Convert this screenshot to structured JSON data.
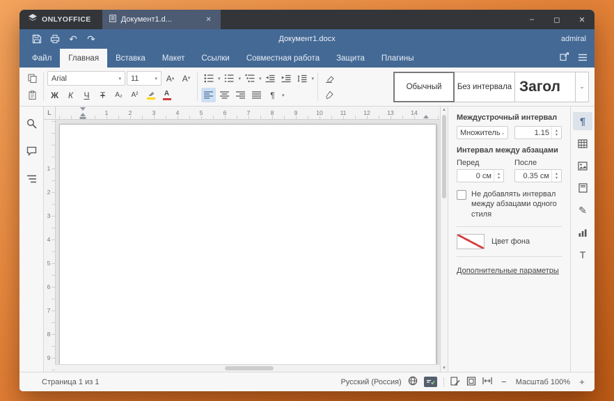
{
  "window": {
    "brand": "ONLYOFFICE",
    "doc_tab": "Документ1.d...",
    "tab_close": "✕",
    "controls": {
      "minimize": "–",
      "maximize": "◻",
      "close": "✕"
    }
  },
  "header": {
    "title": "Документ1.docx",
    "user": "admiral"
  },
  "menu": {
    "tabs": [
      {
        "label": "Файл"
      },
      {
        "label": "Главная"
      },
      {
        "label": "Вставка"
      },
      {
        "label": "Макет"
      },
      {
        "label": "Ссылки"
      },
      {
        "label": "Совместная работа"
      },
      {
        "label": "Защита"
      },
      {
        "label": "Плагины"
      }
    ]
  },
  "toolbar": {
    "font_name": "Arial",
    "font_size": "11",
    "bold": "Ж",
    "italic": "К",
    "underline": "Ч",
    "strikethrough": "Ŧ",
    "subscript": "A₂",
    "superscript": "A²",
    "increase_font": "A",
    "decrease_font": "A",
    "font_color_letter": "А",
    "pilcrow": "¶",
    "styles": [
      {
        "label": "Обычный"
      },
      {
        "label": "Без интервала"
      },
      {
        "label": "Загол"
      }
    ]
  },
  "rulers": {
    "tab_selector": "L",
    "horizontal": [
      "1",
      "2",
      "3",
      "4",
      "5",
      "6",
      "7",
      "8",
      "9",
      "10",
      "11",
      "12",
      "13",
      "14"
    ],
    "vertical": [
      "1",
      "2",
      "3",
      "4",
      "5",
      "6",
      "7",
      "8",
      "9"
    ]
  },
  "right_panel": {
    "line_spacing_title": "Междустрочный интервал",
    "multiplier": "Множитель",
    "multiplier_value": "1.15",
    "paragraph_spacing_title": "Интервал между абзацами",
    "before_label": "Перед",
    "after_label": "После",
    "before_value": "0 см",
    "after_value": "0.35 см",
    "checkbox_label": "Не добавлять интервал между абзацами одного стиля",
    "background_label": "Цвет фона",
    "advanced_link": "Дополнительные параметры"
  },
  "status": {
    "page": "Страница 1 из 1",
    "language": "Русский (Россия)",
    "zoom_label": "Масштаб 100%",
    "zoom_out": "−",
    "zoom_in": "+"
  },
  "icons": {
    "undo": "↶",
    "redo": "↷",
    "caret": "▾",
    "chevron": "⌄",
    "spin_up": "▴",
    "spin_down": "▾",
    "scroll_up": "▲",
    "scroll_down": "▼",
    "pencil": "✎",
    "paragraph": "¶",
    "textart": "Т"
  },
  "colors": {
    "accent": "#446995",
    "titlebar": "#333538",
    "no_fill": "#d43f3f",
    "selection": "#cfe0f5"
  }
}
